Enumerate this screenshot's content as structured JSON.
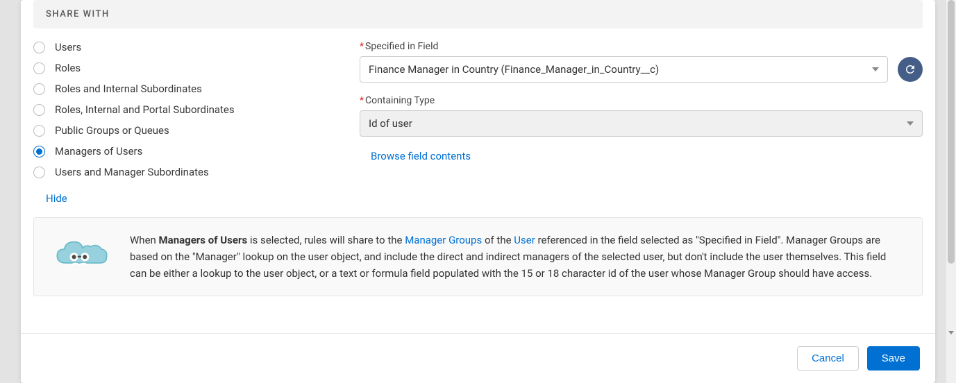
{
  "section": {
    "title": "SHARE WITH"
  },
  "radio": {
    "options": [
      {
        "label": "Users",
        "selected": false
      },
      {
        "label": "Roles",
        "selected": false
      },
      {
        "label": "Roles and Internal Subordinates",
        "selected": false
      },
      {
        "label": "Roles, Internal and Portal Subordinates",
        "selected": false
      },
      {
        "label": "Public Groups or Queues",
        "selected": false
      },
      {
        "label": "Managers of Users",
        "selected": true
      },
      {
        "label": "Users and Manager Subordinates",
        "selected": false
      }
    ]
  },
  "hide_label": "Hide",
  "fields": {
    "specified": {
      "label": "Specified in Field",
      "value": "Finance Manager in Country (Finance_Manager_in_Country__c)"
    },
    "containing_type": {
      "label": "Containing Type",
      "value": "Id of user"
    },
    "browse_label": "Browse field contents"
  },
  "info": {
    "prefix": "When ",
    "bold": "Managers of Users",
    "mid1": " is selected, rules will share to the ",
    "link1": "Manager Groups",
    "mid2": " of the ",
    "link2": "User",
    "rest": " referenced in the field selected as \"Specified in Field\". Manager Groups are based on the \"Manager\" lookup on the user object, and include the direct and indirect managers of the selected user, but don't include the user themselves. This field can be either a lookup to the user object, or a text or formula field populated with the 15 or 18 character id of the user whose Manager Group should have access."
  },
  "buttons": {
    "cancel": "Cancel",
    "save": "Save"
  }
}
